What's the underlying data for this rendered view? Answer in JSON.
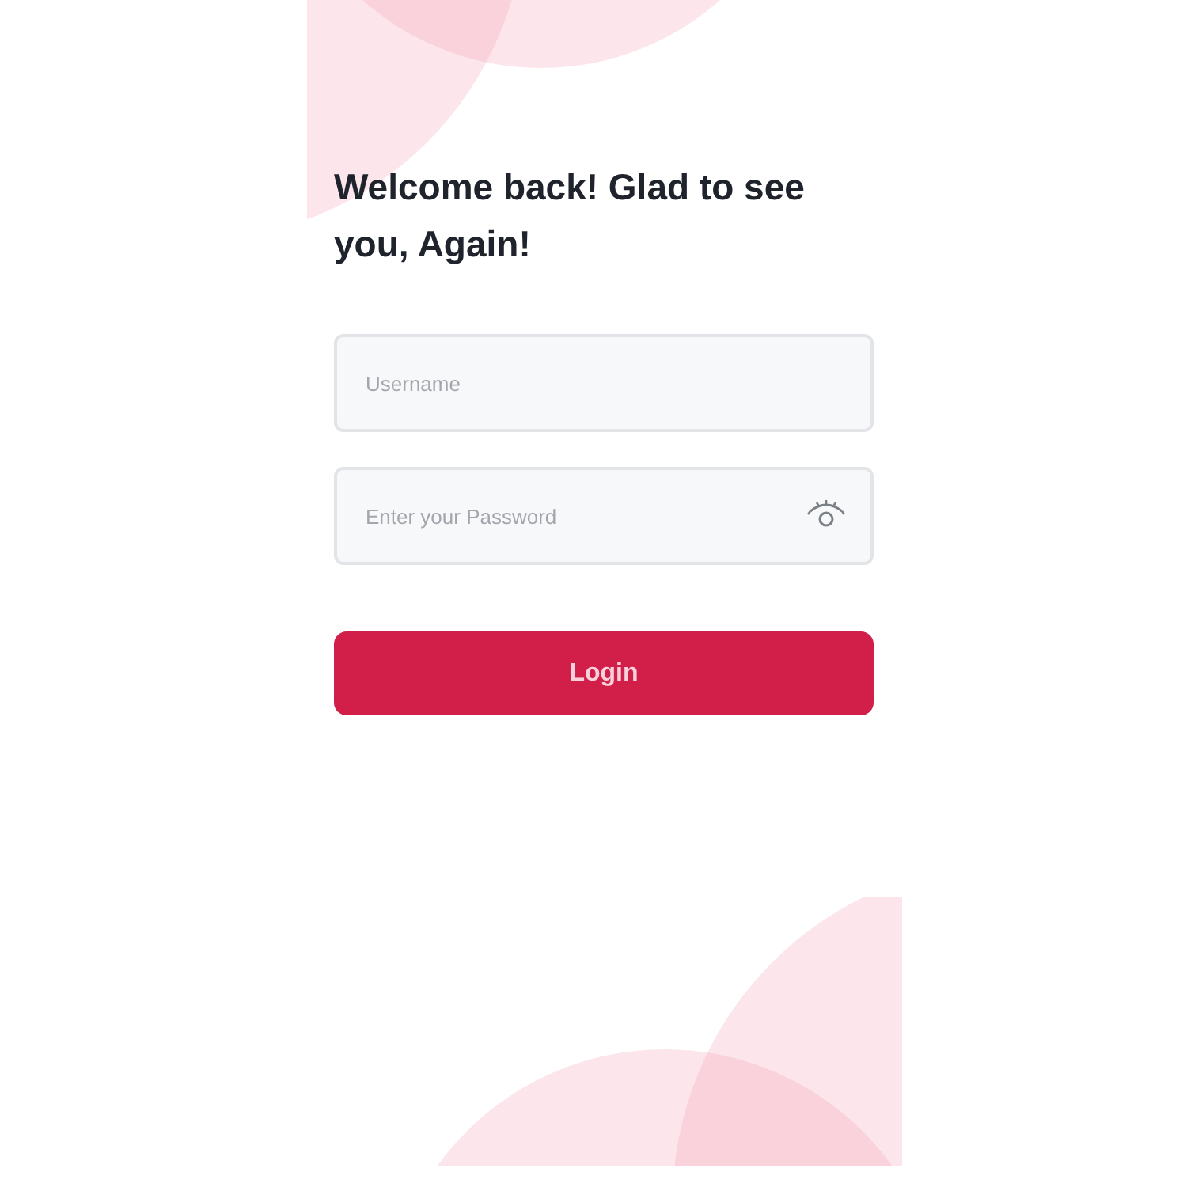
{
  "title": "Welcome back! Glad to see you, Again!",
  "fields": [
    {
      "kind": "text",
      "placeholder": "Username"
    },
    {
      "kind": "password",
      "placeholder": "Enter your Password"
    }
  ],
  "login_button": {
    "label": "Login"
  }
}
